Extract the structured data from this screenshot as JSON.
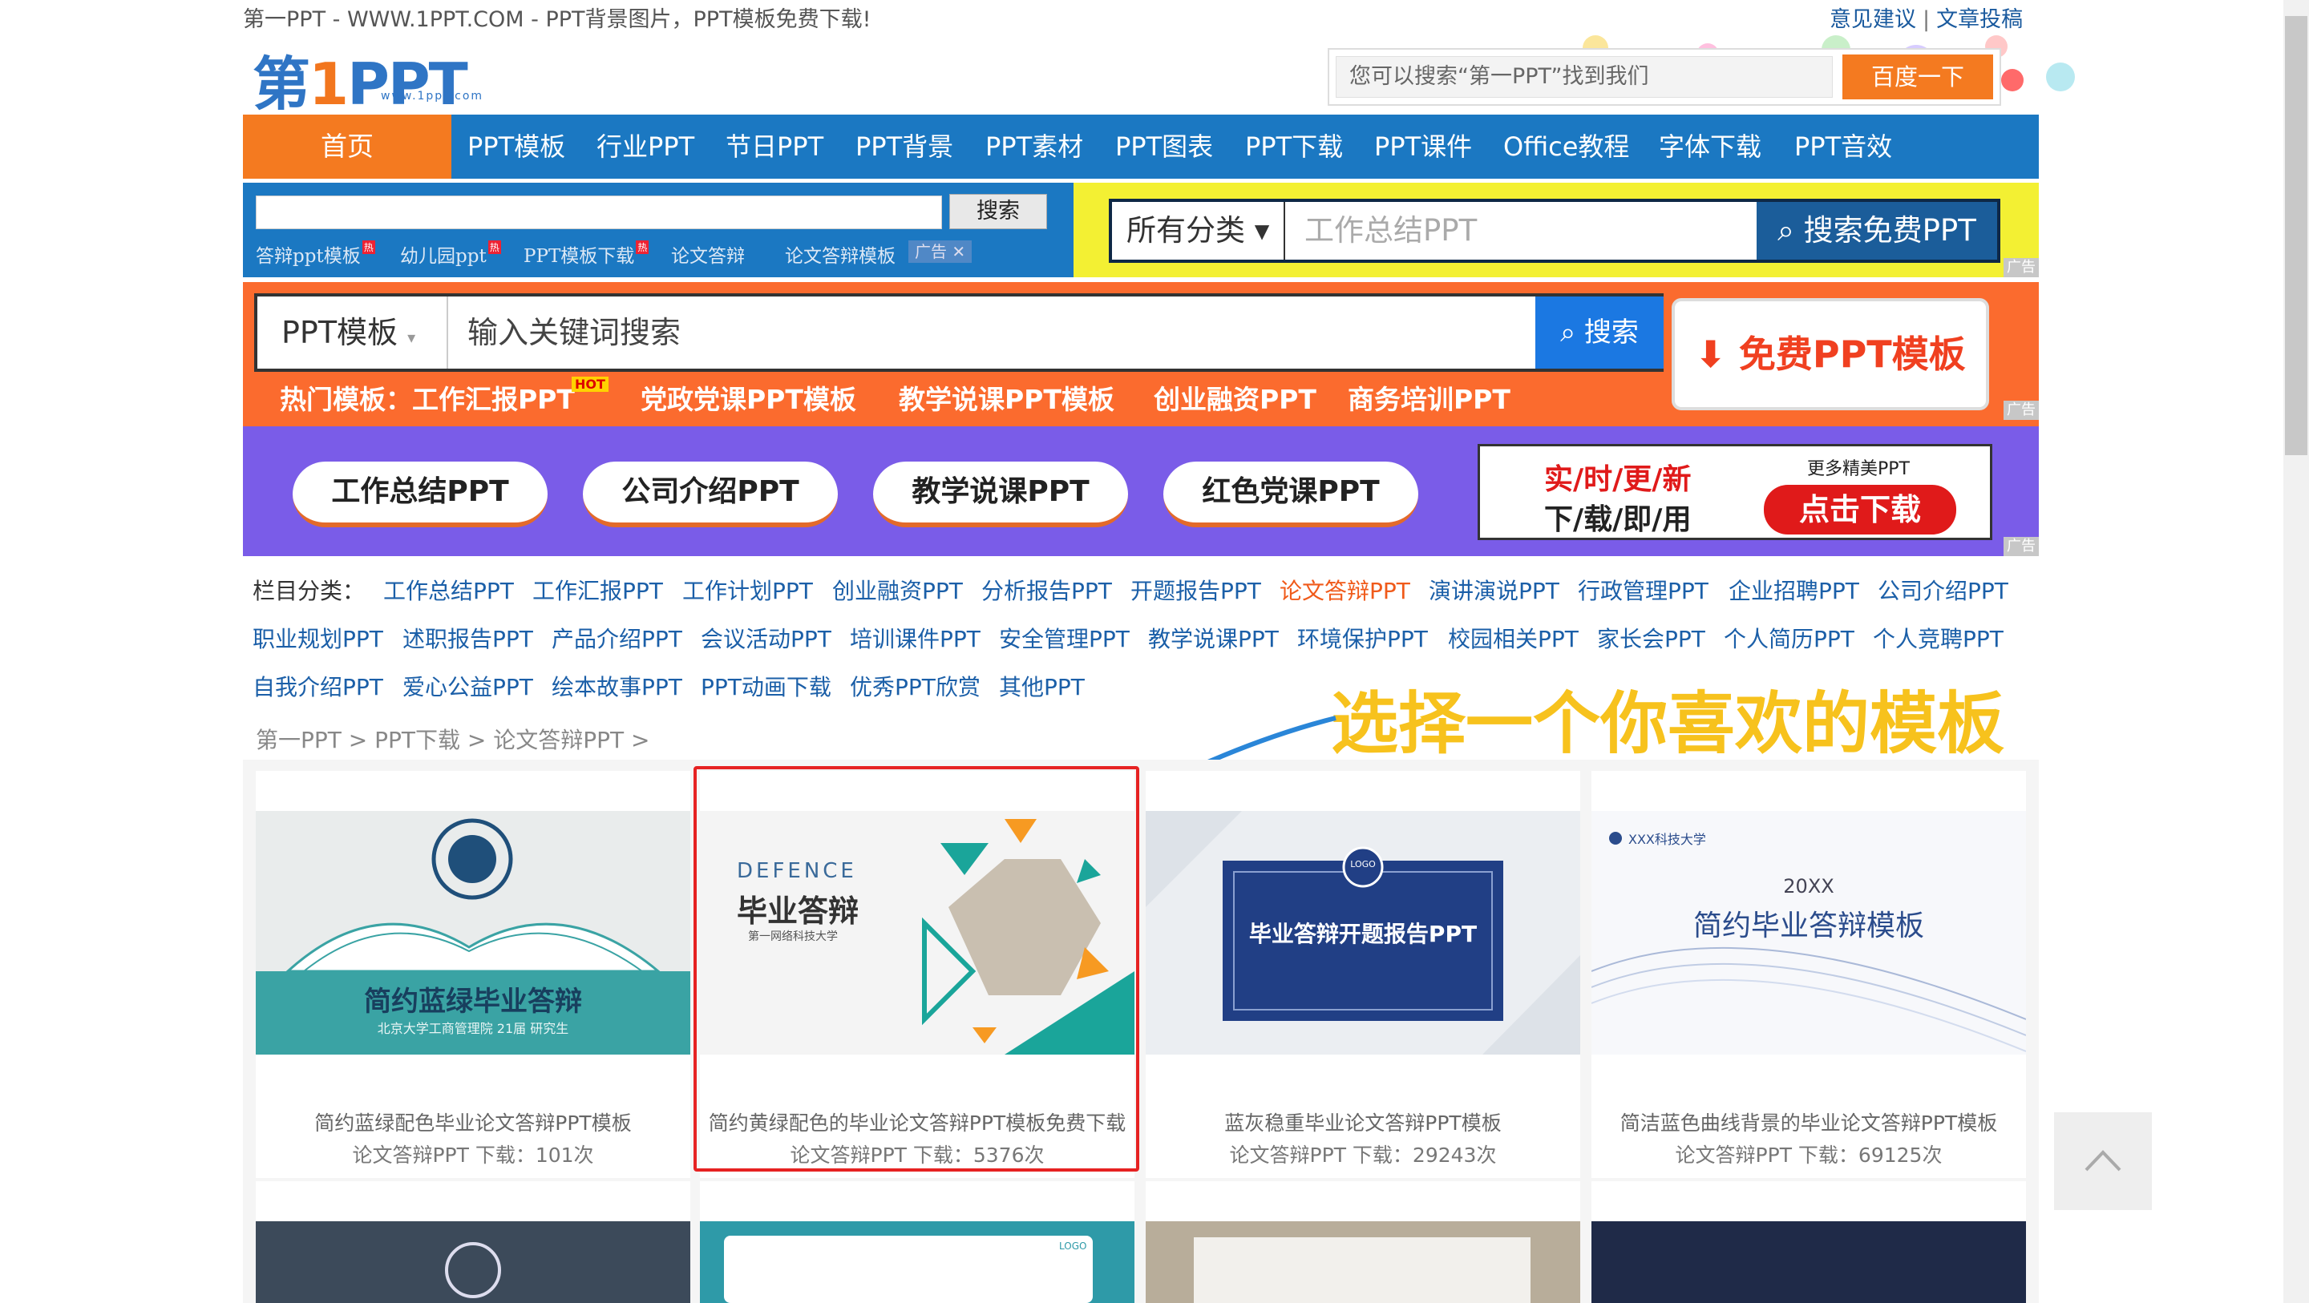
{
  "top": {
    "slogan": "第一PPT - WWW.1PPT.COM - PPT背景图片，PPT模板免费下载!",
    "links": [
      "意见建议",
      "文章投稿"
    ],
    "sep": "|"
  },
  "logo": {
    "main": "第",
    "one": "1",
    "ppt": "PPT",
    "url": "www.1ppt.com"
  },
  "header_search": {
    "placeholder": "您可以搜索“第一PPT”找到我们",
    "button": "百度一下"
  },
  "nav": {
    "home": "首页",
    "items": [
      "PPT模板",
      "行业PPT",
      "节日PPT",
      "PPT背景",
      "PPT素材",
      "PPT图表",
      "PPT下载",
      "PPT课件",
      "Office教程",
      "字体下载",
      "PPT音效"
    ]
  },
  "site_search": {
    "button": "搜索",
    "hot": [
      "答辩ppt模板",
      "幼儿园ppt",
      "PPT模板下载",
      "论文答辩",
      "论文答辩模板"
    ],
    "hot_badge": "热",
    "ad_tag": "广告"
  },
  "category_search": {
    "select": "所有分类",
    "placeholder": "工作总结PPT",
    "button": "搜索免费PPT",
    "ad": "广告"
  },
  "orange_search": {
    "select": "PPT模板",
    "placeholder": "输入关键词搜索",
    "button": "搜索",
    "free_button": "免费PPT模板",
    "hot_label": "热门模板：工作汇报PPT",
    "hot_badge": "HOT",
    "keywords": [
      "党政党课PPT模板",
      "教学说课PPT模板",
      "创业融资PPT",
      "商务培训PPT"
    ],
    "ad": "广告"
  },
  "purple": {
    "pills": [
      "工作总结PPT",
      "公司介绍PPT",
      "教学说课PPT",
      "红色党课PPT"
    ],
    "ad_line1": "实/时/更/新",
    "ad_line2": "下/载/即/用",
    "ad_more": "更多精美PPT",
    "ad_button": "点击下载",
    "ad": "广告"
  },
  "categories": {
    "label": "栏目分类：",
    "rows": [
      [
        "工作总结PPT",
        "工作汇报PPT",
        "工作计划PPT",
        "创业融资PPT",
        "分析报告PPT",
        "开题报告PPT",
        "论文答辩PPT",
        "演讲演说PPT",
        "行政管理PPT",
        "企业招聘PPT",
        "公司介绍PPT"
      ],
      [
        "职业规划PPT",
        "述职报告PPT",
        "产品介绍PPT",
        "会议活动PPT",
        "培训课件PPT",
        "安全管理PPT",
        "教学说课PPT",
        "环境保护PPT",
        "校园相关PPT",
        "家长会PPT",
        "个人简历PPT",
        "个人竞聘PPT"
      ],
      [
        "自我介绍PPT",
        "爱心公益PPT",
        "绘本故事PPT",
        "PPT动画下载",
        "优秀PPT欣赏",
        "其他PPT"
      ]
    ],
    "active": "论文答辩PPT"
  },
  "breadcrumb": [
    "第一PPT",
    "PPT下载",
    "论文答辩PPT"
  ],
  "annotation": "选择一个你喜欢的模板",
  "cards": [
    {
      "title": "简约蓝绿配色毕业论文答辩PPT模板",
      "meta": "论文答辩PPT  下载：101次",
      "thumb_title": "简约蓝绿毕业答辩",
      "thumb_sub": "北京大学工商管理院 21届 研究生",
      "highlighted": false
    },
    {
      "title": "简约黄绿配色的毕业论文答辩PPT模板免费下载",
      "meta": "论文答辩PPT  下载：5376次",
      "thumb_title": "毕业答辩",
      "thumb_en": "DEFENCE",
      "thumb_sub": "第一网络科技大学",
      "highlighted": true
    },
    {
      "title": "蓝灰稳重毕业论文答辩PPT模板",
      "meta": "论文答辩PPT  下载：29243次",
      "thumb_title": "毕业答辩开题报告PPT",
      "thumb_logo": "LOGO",
      "highlighted": false
    },
    {
      "title": "简洁蓝色曲线背景的毕业论文答辩PPT模板",
      "meta": "论文答辩PPT  下载：69125次",
      "thumb_title": "简约毕业答辩模板",
      "thumb_year": "20XX",
      "thumb_school": "XXX科技大学",
      "highlighted": false
    }
  ],
  "second_row_logo": "LOGO",
  "colors": {
    "nav_blue": "#1b78c2",
    "orange": "#f47a20",
    "purple": "#7a5ce8",
    "yellow": "#f3f033",
    "highlight": "#e62222",
    "annotation": "#f7c21d"
  }
}
